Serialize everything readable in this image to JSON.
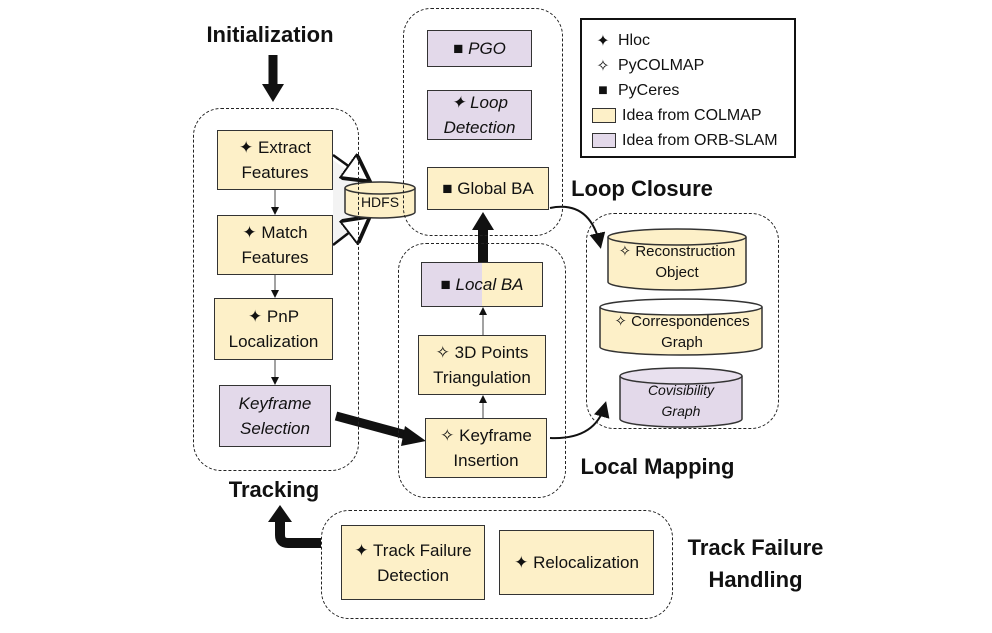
{
  "labels": {
    "initialization": "Initialization",
    "tracking": "Tracking",
    "loop_closure": "Loop Closure",
    "local_mapping": "Local Mapping",
    "track_failure": "Track Failure Handling"
  },
  "tracking": {
    "extract": "Extract Features",
    "match": "Match Features",
    "pnp": "PnP Localization",
    "keyframe_selection": "Keyframe Selection"
  },
  "storage": {
    "hdfs": "HDFS"
  },
  "loop": {
    "pgo": "PGO",
    "loop_detection": "Loop Detection",
    "global_ba": "Global BA"
  },
  "mapping": {
    "local_ba": "Local BA",
    "triangulation": "3D Points Triangulation",
    "keyframe_insertion": "Keyframe Insertion"
  },
  "data": {
    "reconstruction": "Reconstruction Object",
    "correspondences": "Correspondences Graph",
    "covisibility": "Covisibility Graph"
  },
  "failure": {
    "detection": "Track Failure Detection",
    "relocalization": "Relocalization"
  },
  "legend": {
    "hloc": "Hloc",
    "pycolmap": "PyCOLMAP",
    "pyceres": "PyCeres",
    "colmap": "Idea from COLMAP",
    "orbslam": "Idea from ORB-SLAM"
  },
  "symbols": {
    "hloc": "✦",
    "pycolmap": "✧",
    "pyceres": "■"
  },
  "colors": {
    "colmap": "#fdf0c8",
    "orbslam": "#e3d9ea"
  }
}
